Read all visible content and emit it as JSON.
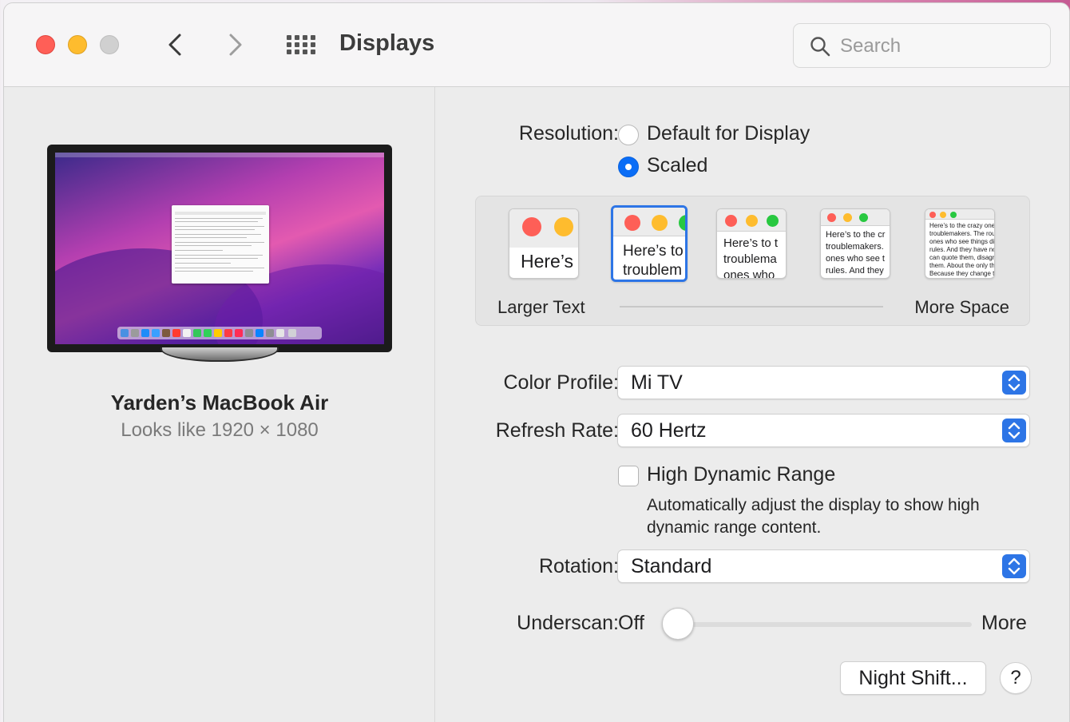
{
  "window": {
    "title": "Displays"
  },
  "search": {
    "placeholder": "Search"
  },
  "device": {
    "name": "Yarden’s MacBook Air",
    "resolution_text": "Looks like 1920 × 1080"
  },
  "resolution": {
    "label": "Resolution:",
    "options": [
      {
        "label": "Default for Display",
        "selected": false
      },
      {
        "label": "Scaled",
        "selected": true
      }
    ]
  },
  "scaling": {
    "left_label": "Larger Text",
    "right_label": "More Space",
    "selected_index": 1,
    "thumbs": [
      {
        "line1": "Here’s",
        "line2": ""
      },
      {
        "line1": "Here’s to",
        "line2": "troublem"
      },
      {
        "line1": "Here’s to t",
        "line2": "troublema",
        "line3": "ones who"
      },
      {
        "line1": "Here’s to the cr",
        "line2": "troublemakers.",
        "line3": "ones who see t",
        "line4": "rules. And they"
      },
      {
        "line1": "Here’s to the crazy one",
        "line2": "troublemakers. The rou",
        "line3": "ones who see things dif",
        "line4": "rules. And they have no",
        "line5": "can quote them, disagre",
        "line6": "them. About the only th",
        "line7": "Because they change th"
      }
    ]
  },
  "color_profile": {
    "label": "Color Profile:",
    "value": "Mi TV"
  },
  "refresh_rate": {
    "label": "Refresh Rate:",
    "value": "60 Hertz"
  },
  "hdr": {
    "label": "High Dynamic Range",
    "checked": false,
    "description_line1": "Automatically adjust the display to show high",
    "description_line2": "dynamic range content."
  },
  "rotation": {
    "label": "Rotation:",
    "value": "Standard"
  },
  "underscan": {
    "label": "Underscan:",
    "min_label": "Off",
    "max_label": "More",
    "value": 0
  },
  "buttons": {
    "night_shift": "Night Shift...",
    "help": "?"
  },
  "colors": {
    "accent": "#2d75e6",
    "close": "#ff5f57",
    "minimize": "#febc2e",
    "maximize": "#d0d0d0"
  }
}
